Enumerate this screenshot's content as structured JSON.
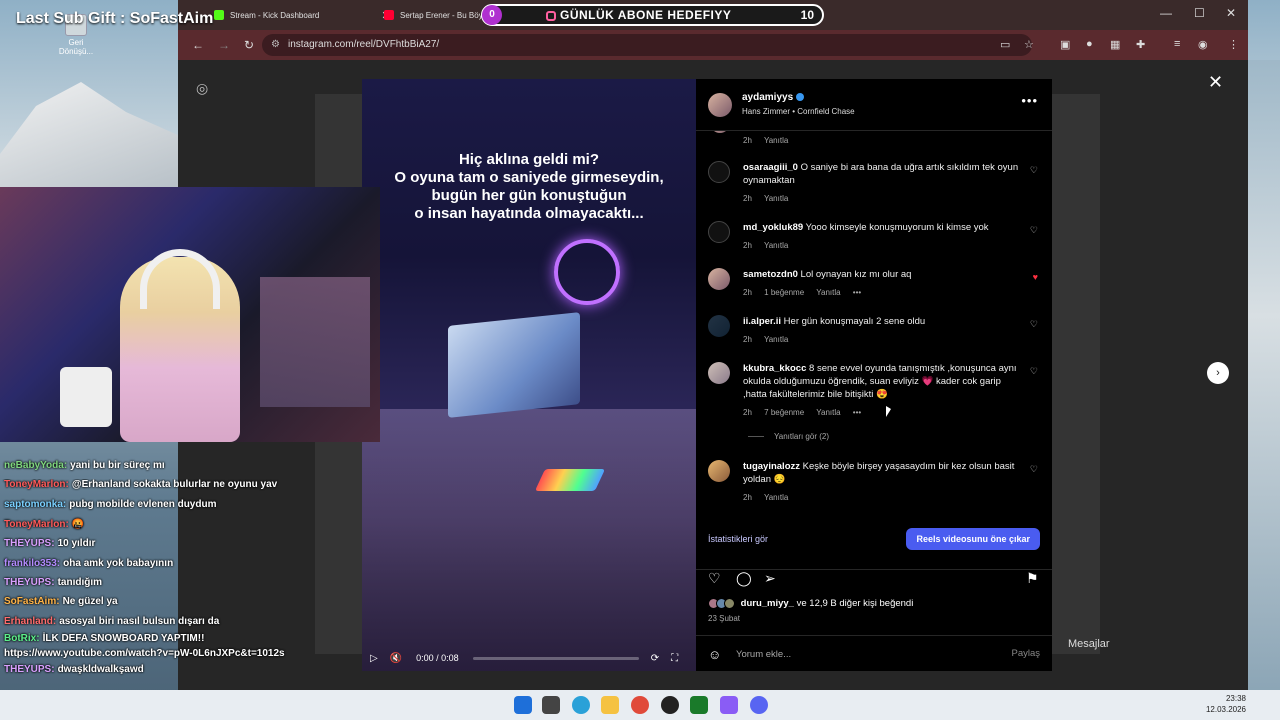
{
  "overlay": {
    "banner": "Last Sub Gift : SoFastAim",
    "goal": {
      "count": "0",
      "title": "GÜNLÜK ABONE HEDEFIYY",
      "target": "10"
    }
  },
  "desktop": {
    "recycle_label": "Geri Dönüşü..."
  },
  "browser": {
    "tabs": [
      {
        "title": "Stream - Kick Dashboard"
      },
      {
        "title": "Sertap Erener - Bu Böyle"
      }
    ],
    "url": "instagram.com/reel/DVFhtbBiA27/"
  },
  "reel": {
    "caption": "Hiç aklına geldi mi?\nO oyuna tam o saniyede girmeseydin,\nbugün her gün konuştuğun\no insan hayatında olmayacaktı...",
    "time": "0:00 / 0:08"
  },
  "post": {
    "username": "aydamiyys",
    "music": "Hans Zimmer • Cornfield Chase",
    "comments": [
      {
        "user": "",
        "text": "",
        "time": "2h",
        "likes": "",
        "reply": "Yanıtla",
        "liked": false
      },
      {
        "user": "osaraagiii_0",
        "text": "O saniye bi ara bana da uğra artık sıkıldım tek oyun oynamaktan",
        "time": "2h",
        "likes": "",
        "reply": "Yanıtla",
        "liked": false
      },
      {
        "user": "md_yokluk89",
        "text": "Yooo kimseyle konuşmuyorum ki kimse yok",
        "time": "2h",
        "likes": "",
        "reply": "Yanıtla",
        "liked": false
      },
      {
        "user": "sametozdn0",
        "text": "Lol oynayan kız mı olur aq",
        "time": "2h",
        "likes": "1 beğenme",
        "reply": "Yanıtla",
        "liked": true
      },
      {
        "user": "ii.alper.ii",
        "text": "Her gün konuşmayalı 2 sene oldu",
        "time": "2h",
        "likes": "",
        "reply": "Yanıtla",
        "liked": false
      },
      {
        "user": "kkubra_kkocc",
        "text": "8 sene evvel oyunda tanışmıştık ,konuşunca aynı okulda olduğumuzu öğrendik, suan evliyiz 💗 kader cok garip ,hatta fakültelerimiz bile bitişikti 😍",
        "time": "2h",
        "likes": "7 beğenme",
        "reply": "Yanıtla",
        "liked": false
      },
      {
        "user": "tugayinalozz",
        "text": "Keşke böyle birşey yaşasaydım bir kez olsun basit yoldan 😔",
        "time": "2h",
        "likes": "",
        "reply": "Yanıtla",
        "liked": false
      }
    ],
    "replies_label": "Yanıtları gör (2)",
    "stats_label": "İstatistikleri gör",
    "promote_label": "Reels videosunu öne çıkar",
    "likes_user": "duru_miyy_",
    "likes_rest": "ve 12,9 B diğer kişi beğendi",
    "date": "23 Şubat",
    "comment_placeholder": "Yorum ekle...",
    "share_label": "Paylaş",
    "messages_label": "Mesajlar"
  },
  "chat": [
    {
      "user": "neBabyYoda:",
      "msg": "yani bu bir süreç mı",
      "color": "#7fd67f"
    },
    {
      "user": "ToneyMarlon:",
      "msg": "@Erhanland sokakta bulurlar ne oyunu yav",
      "color": "#ff5a5a"
    },
    {
      "user": "saptomonka:",
      "msg": "pubg mobilde evlenen duydum",
      "color": "#7ad0ff"
    },
    {
      "user": "ToneyMarlon:",
      "msg": "🤬",
      "color": "#ff5a5a"
    },
    {
      "user": "THEYUPS:",
      "msg": "10 yıldır",
      "color": "#d9a0ff"
    },
    {
      "user": "frankilo353:",
      "msg": "oha amk yok babayının",
      "color": "#b38bff"
    },
    {
      "user": "THEYUPS:",
      "msg": "tanıdığım",
      "color": "#d9a0ff"
    },
    {
      "user": "SoFastAim:",
      "msg": "Ne güzel ya",
      "color": "#ffb347"
    },
    {
      "user": "Erhanland:",
      "msg": "asosyal biri nasıl bulsun dışarı da",
      "color": "#ff6b6b"
    },
    {
      "user": "BotRix:",
      "msg": "İLK DEFA SNOWBOARD YAPTIM!!",
      "color": "#5cf08a"
    },
    {
      "user": "",
      "msg": "https://www.youtube.com/watch?v=pW-0L6nJXPc&t=1012s",
      "color": "#ffffff"
    },
    {
      "user": "THEYUPS:",
      "msg": "dwaşkldwalkşawd",
      "color": "#d9a0ff"
    }
  ],
  "taskbar": {
    "time": "23:38",
    "date": "12.03.2026"
  },
  "colors": {
    "instagram_blue": "#4a5cf0",
    "heart_red": "#ff3040",
    "browser_frame": "#5a2a2e"
  }
}
